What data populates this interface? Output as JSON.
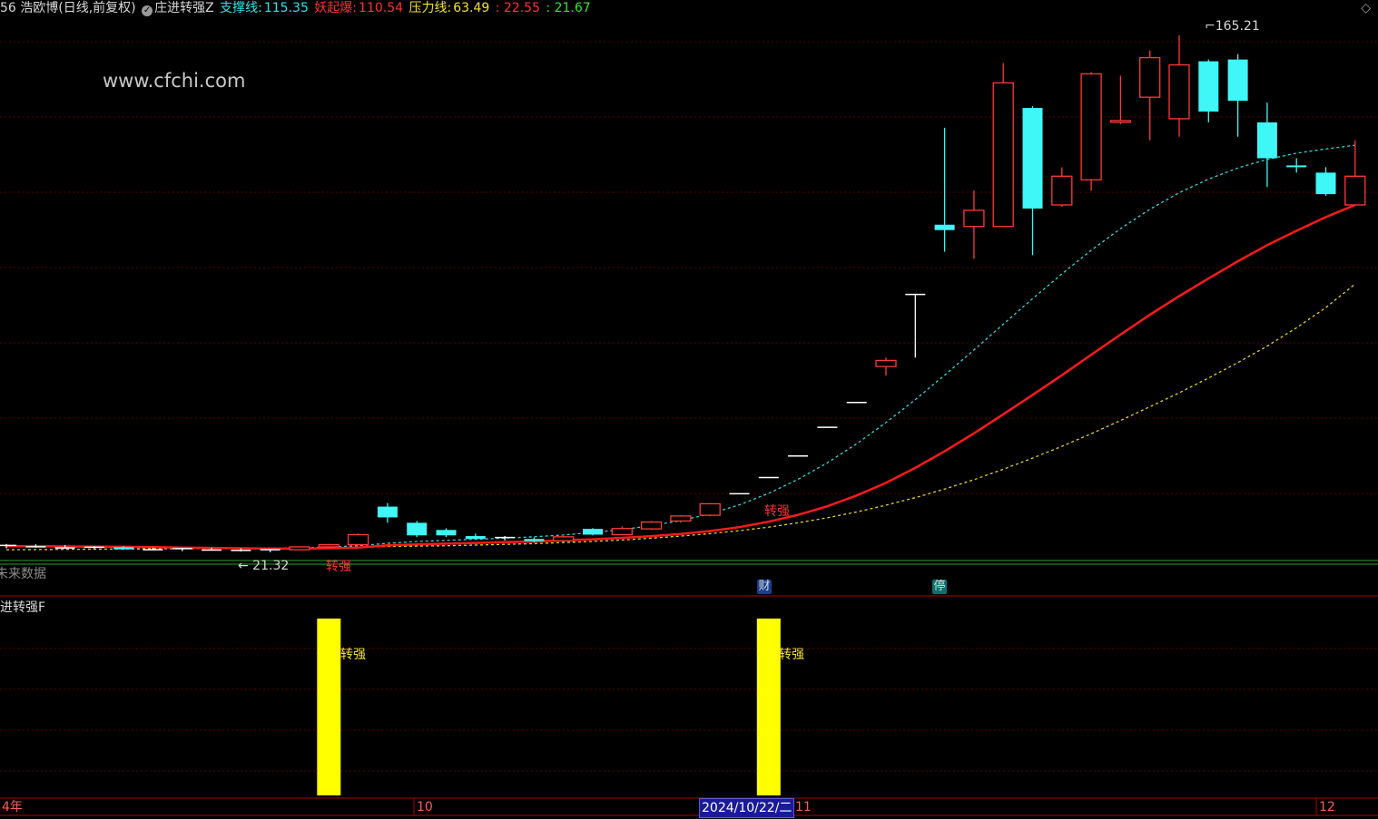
{
  "header": {
    "stock_name": "56 浩欧博(日线,前复权)",
    "indicator_toggle": "✓",
    "indicator_name": "庄进转强Z",
    "support_label": "支撑线:",
    "support_value": "115.35",
    "yao_label": "妖起爆:",
    "yao_value": "110.54",
    "pressure_label": "压力线:",
    "pressure_value": "63.49",
    "v1": ": 22.55",
    "v2": ": 21.67",
    "menu_icon": "diamond-icon"
  },
  "watermark": "www.cfchi.com",
  "main_panel": {
    "high_label": "165.21",
    "low_label": "← 21.32",
    "signal_label": "转强",
    "future_data_label": "未来数据",
    "badges": [
      {
        "text": "财",
        "color": "#1b3f8f"
      },
      {
        "text": "停",
        "color": "#0f6f6f"
      }
    ]
  },
  "sub_panel": {
    "title": "庄进转强F",
    "bar_label": "转强"
  },
  "time_axis": {
    "labels": [
      "4年",
      "10",
      "11",
      "12"
    ],
    "cursor_date": "2024/10/22/二"
  },
  "colors": {
    "up": "#ff3a3a",
    "down": "#3ff7f7",
    "ma_main": "#ff1a1a",
    "ma_dotted_cyan": "#34d6e0",
    "ma_dotted_yellow": "#e6d02a",
    "grid": "#5a0000",
    "bar": "#ffff00"
  },
  "chart_data": {
    "type": "candlestick",
    "ohlc": [
      [
        23.0,
        23.6,
        22.4,
        23.2
      ],
      [
        23.1,
        23.5,
        22.6,
        22.8
      ],
      [
        22.9,
        23.3,
        22.3,
        22.5
      ],
      [
        22.6,
        23.0,
        22.2,
        22.7
      ],
      [
        22.7,
        23.0,
        22.0,
        22.1
      ],
      [
        22.2,
        22.6,
        21.8,
        22.0
      ],
      [
        22.0,
        22.5,
        21.6,
        22.3
      ],
      [
        22.2,
        22.6,
        21.8,
        21.9
      ],
      [
        22.0,
        22.4,
        21.5,
        21.8
      ],
      [
        21.7,
        22.2,
        21.32,
        22.0
      ],
      [
        22.0,
        22.9,
        21.9,
        22.8
      ],
      [
        22.8,
        23.6,
        22.5,
        23.4
      ],
      [
        23.4,
        26.5,
        23.2,
        26.2
      ],
      [
        34.0,
        35.0,
        29.5,
        31.0
      ],
      [
        29.5,
        30.0,
        25.5,
        26.0
      ],
      [
        27.5,
        28.0,
        25.5,
        26.0
      ],
      [
        25.8,
        26.5,
        24.8,
        25.0
      ],
      [
        25.2,
        25.8,
        24.6,
        25.4
      ],
      [
        25.0,
        25.5,
        24.0,
        24.4
      ],
      [
        24.5,
        25.8,
        24.2,
        25.6
      ],
      [
        27.8,
        28.0,
        26.0,
        26.2
      ],
      [
        26.2,
        28.5,
        26.0,
        27.9
      ],
      [
        27.8,
        30.0,
        27.5,
        29.7
      ],
      [
        30.0,
        31.6,
        29.5,
        31.4
      ],
      [
        31.6,
        35.0,
        31.3,
        34.8
      ],
      [
        37.5,
        37.7,
        37.5,
        37.6
      ],
      [
        42.0,
        42.2,
        42.0,
        42.1
      ],
      [
        48.0,
        48.2,
        48.0,
        48.1
      ],
      [
        56.0,
        56.2,
        56.0,
        56.1
      ],
      [
        62.8,
        63.0,
        62.8,
        63.0
      ],
      [
        73.0,
        75.5,
        70.5,
        74.7
      ],
      [
        93.0,
        93.2,
        75.5,
        93.1
      ],
      [
        112.5,
        139.5,
        105.0,
        111.0
      ],
      [
        112.0,
        122.0,
        103.0,
        116.5
      ],
      [
        112.0,
        157.5,
        112.0,
        152.0
      ],
      [
        145.0,
        145.5,
        104.0,
        117.0
      ],
      [
        118.0,
        128.5,
        117.5,
        126.0
      ],
      [
        125.0,
        155.0,
        122.0,
        154.5
      ],
      [
        141.0,
        154.0,
        140.5,
        141.5
      ],
      [
        148.0,
        161.0,
        136.0,
        159.0
      ],
      [
        142.0,
        165.21,
        137.0,
        157.0
      ],
      [
        158.0,
        158.5,
        141.0,
        144.0
      ],
      [
        158.5,
        160.0,
        137.0,
        147.0
      ],
      [
        141.0,
        146.5,
        123.0,
        131.0
      ],
      [
        129.0,
        131.0,
        127.0,
        128.5
      ],
      [
        127.0,
        128.5,
        120.5,
        121.0
      ],
      [
        118.0,
        136.0,
        118.0,
        126.0
      ]
    ],
    "ma_red": [
      23.0,
      22.95,
      22.9,
      22.85,
      22.8,
      22.7,
      22.6,
      22.5,
      22.4,
      22.3,
      22.3,
      22.4,
      22.6,
      23.2,
      23.5,
      23.7,
      23.9,
      24.1,
      24.3,
      24.6,
      24.9,
      25.3,
      25.8,
      26.4,
      27.2,
      28.3,
      29.8,
      31.7,
      34.1,
      37.1,
      40.6,
      44.8,
      49.4,
      54.4,
      59.7,
      65.1,
      70.6,
      76.3,
      81.9,
      87.4,
      92.6,
      97.5,
      102.3,
      106.8,
      110.8,
      114.6,
      118.0
    ],
    "ma_cyan": [
      23.1,
      23.0,
      22.9,
      22.8,
      22.7,
      22.6,
      22.5,
      22.45,
      22.4,
      22.4,
      22.5,
      22.7,
      23.1,
      23.8,
      24.3,
      24.6,
      24.9,
      25.2,
      25.6,
      26.1,
      26.8,
      27.6,
      28.7,
      30.1,
      32.0,
      34.5,
      37.7,
      41.6,
      46.2,
      51.5,
      57.4,
      63.8,
      70.6,
      77.6,
      84.8,
      91.9,
      98.8,
      105.4,
      111.4,
      116.8,
      121.4,
      125.2,
      128.3,
      130.7,
      132.4,
      133.6,
      134.6
    ],
    "ma_yellow": [
      22.0,
      22.05,
      22.1,
      22.15,
      22.2,
      22.25,
      22.3,
      22.35,
      22.4,
      22.45,
      22.5,
      22.6,
      22.7,
      22.9,
      23.0,
      23.1,
      23.3,
      23.5,
      23.7,
      24.0,
      24.3,
      24.7,
      25.2,
      25.8,
      26.5,
      27.3,
      28.3,
      29.5,
      30.9,
      32.5,
      34.4,
      36.5,
      38.9,
      41.5,
      44.4,
      47.5,
      50.8,
      54.3,
      58.0,
      61.8,
      65.7,
      69.8,
      74.1,
      78.7,
      83.8,
      89.4,
      96.0
    ],
    "yrange": [
      19.5,
      168.5
    ],
    "signal_bars": [
      11,
      26
    ]
  }
}
